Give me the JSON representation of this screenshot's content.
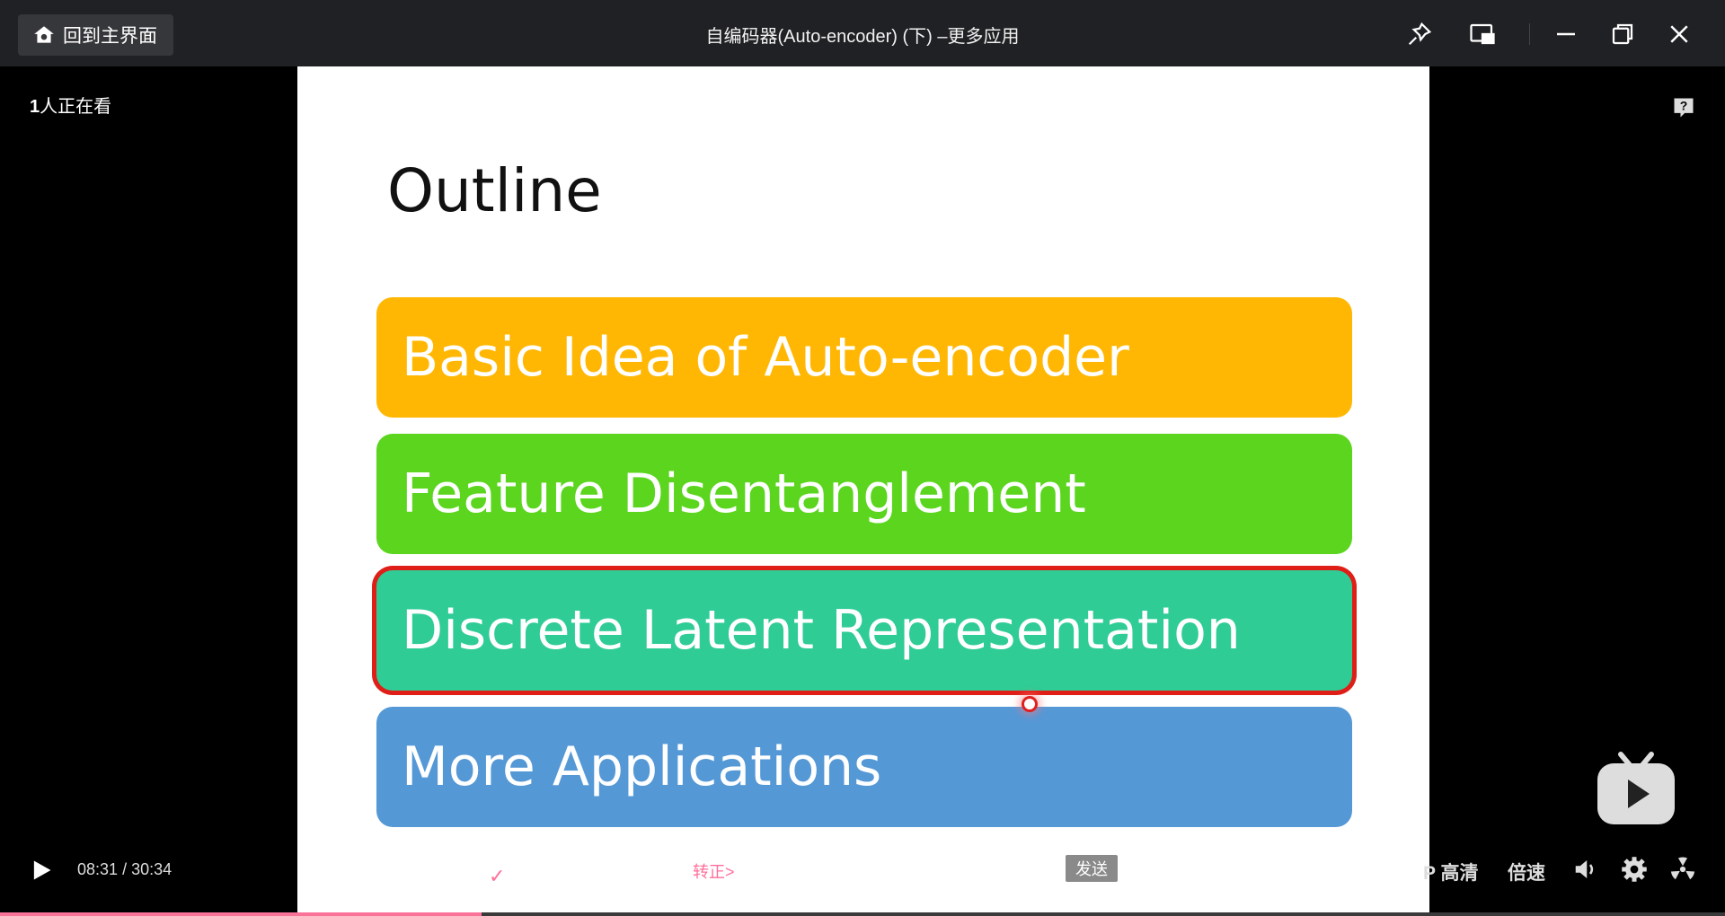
{
  "titlebar": {
    "home_label": "回到主界面",
    "window_title": "自编码器(Auto-encoder) (下) –更多应用"
  },
  "stage": {
    "viewers_count": "1",
    "viewers_suffix": "人正在看"
  },
  "slide": {
    "title": "Outline",
    "items": [
      {
        "label": "Basic Idea of Auto-encoder",
        "color": "#ffb703"
      },
      {
        "label": "Feature Disentanglement",
        "color": "#5bd51e"
      },
      {
        "label": "Discrete Latent Representation",
        "color": "#2fcc96",
        "highlight": "#e01e18"
      },
      {
        "label": "More Applications",
        "color": "#5598d6"
      }
    ]
  },
  "controls": {
    "current_time": "08:31",
    "separator": "/",
    "total_time": "30:34",
    "check": "✓",
    "promo_link": "转正>",
    "send_label": "发送",
    "quality_label": "P 高清",
    "speed_label": "倍速",
    "progress_fraction": 0.279
  },
  "colors": {
    "accent": "#fb7299",
    "titlebar": "#202124"
  }
}
